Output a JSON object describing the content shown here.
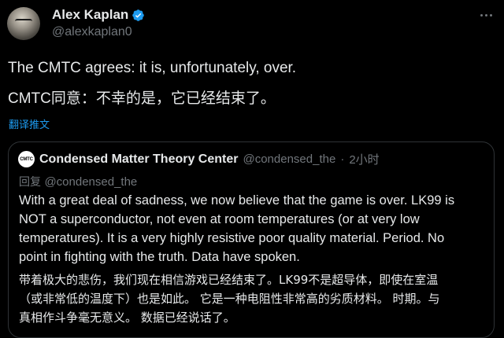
{
  "author": {
    "display_name": "Alex Kaplan",
    "handle": "@alexkaplan0",
    "verified_color": "#1d9bf0"
  },
  "post": {
    "text_en": "The CMTC agrees: it is, unfortunately, over.",
    "text_zh": "CMTC同意：不幸的是，它已经结束了。",
    "translate_label": "翻译推文"
  },
  "quoted": {
    "logo_text": "CMTC",
    "display_name": "Condensed Matter Theory Center",
    "handle": "@condensed_the",
    "separator": "·",
    "time": "2小时",
    "reply_prefix": "回复",
    "reply_to": "@condensed_the",
    "lines_en": [
      "With a great deal of sadness, we now believe that the game is over. LK99 is",
      "NOT a superconductor, not even at room temperatures (or at very low",
      "temperatures).  It is a very highly resistive poor quality material.  Period. No",
      "point in fighting with the truth.  Data have spoken."
    ],
    "lines_zh": [
      "带着极大的悲伤，我们现在相信游戏已经结束了。LK99不是超导体，即使在室温",
      "（或非常低的温度下）也是如此。 它是一种电阻性非常高的劣质材料。 时期。与",
      "真相作斗争毫无意义。 数据已经说话了。"
    ]
  },
  "colors": {
    "background": "#000000",
    "text_primary": "#e7e9ea",
    "text_secondary": "#71767b",
    "accent": "#1d9bf0",
    "border": "#2f3336"
  }
}
